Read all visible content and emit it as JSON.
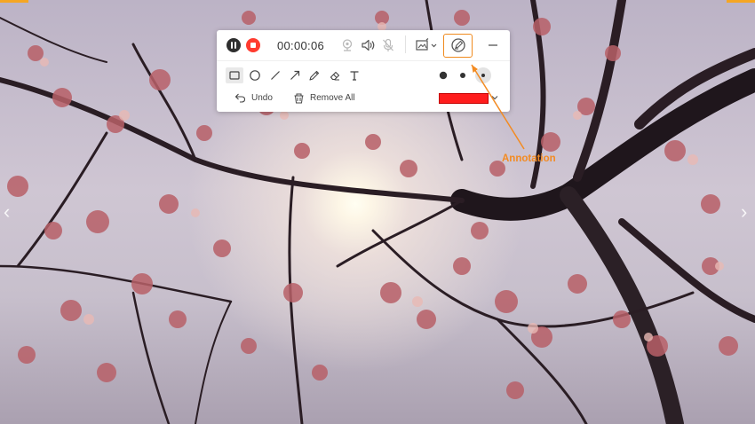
{
  "recorder": {
    "timer": "00:00:06",
    "undo_label": "Undo",
    "remove_all_label": "Remove All"
  },
  "annotation": {
    "callout_label": "Annotation"
  },
  "colors": {
    "accent": "#f08a1e",
    "record_red": "#ff3b2f",
    "pen_color": "#ff1d1d",
    "corner_marker": "#f5a623"
  },
  "icons": {
    "pause": "pause-icon",
    "stop": "stop-icon",
    "webcam": "webcam-icon",
    "speaker": "speaker-icon",
    "microphone": "microphone-muted-icon",
    "screenshot": "screenshot-icon",
    "annotation": "annotation-icon",
    "minimize": "minimize-icon",
    "rectangle": "rectangle-icon",
    "circle": "circle-icon",
    "line": "line-icon",
    "arrow": "arrow-icon",
    "pencil": "pencil-icon",
    "eraser": "eraser-icon",
    "text": "text-icon",
    "undo": "undo-icon",
    "remove_all": "trash-icon",
    "prev": "chevron-left-icon",
    "next": "chevron-right-icon"
  }
}
